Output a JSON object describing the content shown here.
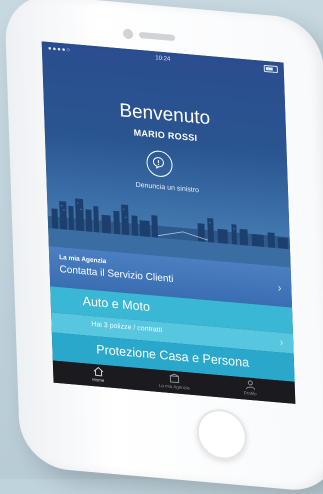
{
  "status_bar": {
    "time": "10:24"
  },
  "hero": {
    "welcome": "Benvenuto",
    "user_name": "MARIO ROSSI",
    "report_claim_label": "Denuncia un sinistro"
  },
  "agency": {
    "title": "La mia Agenzia",
    "action": "Contatta il Servizio Clienti"
  },
  "auto": {
    "title": "Auto e Moto",
    "policies": "Hai 3 polizze / contratti"
  },
  "home_protection": {
    "title": "Protezione Casa e Persona"
  },
  "tabs": [
    {
      "label": "Home",
      "icon": "home-icon"
    },
    {
      "label": "La mia Agenzia",
      "icon": "agency-icon"
    },
    {
      "label": "Profilo",
      "icon": "user-icon"
    }
  ],
  "colors": {
    "hero_top": "#2a4d8f",
    "agency": "#3a6eb2",
    "auto": "#39b7d4",
    "policies": "#56c7df",
    "casa": "#2aa8cc",
    "tabbar": "#1a1a1f"
  }
}
